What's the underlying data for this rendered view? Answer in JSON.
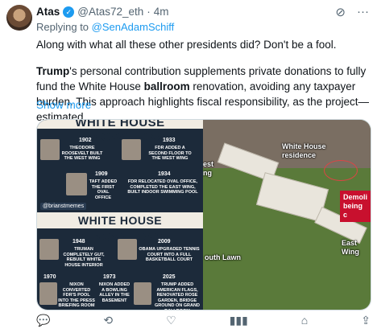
{
  "tweet": {
    "author_name": "Atas",
    "author_handle": "@Atas72_eth",
    "separator": "·",
    "time": "4m",
    "reply_prefix": "Replying to",
    "reply_target": "@SenAdamSchiff",
    "para1": "Along with what all these other presidents did? Don't be a fool.",
    "para2_bold1": "Trump",
    "para2_part1": "'s personal contribution supplements private donations to fully fund the White House ",
    "para2_bold2": "ballroom",
    "para2_part2": " renovation, avoiding any taxpayer burden. This approach highlights fiscal responsibility, as the project—estimated",
    "show_more": "Show more"
  },
  "image_left": {
    "banner_top": "WHITE HOUSE RENOVATIONS",
    "banner_mid": "WHITE HOUSE RENOVATIONS",
    "handle": "@brianstmemes",
    "cards": [
      {
        "year": "1902",
        "caption": "THEODORE ROOSEVELT BUILT THE WEST WING"
      },
      {
        "year": "1933",
        "caption": "FDR ADDED A SECOND FLOOR TO THE WEST WING"
      },
      {
        "year": "1909",
        "caption": "TAFT ADDED THE FIRST OVAL OFFICE"
      },
      {
        "year": "1934",
        "caption": "FDR RELOCATED OVAL OFFICE, COMPLETED THE EAST WING, BUILT INDOOR SWIMMING POOL"
      },
      {
        "year": "1948",
        "caption": "TRUMAN COMPLETELY GUT, REBUILT WHITE HOUSE INTERIOR"
      },
      {
        "year": "2009",
        "caption": "OBAMA UPGRADED TENNIS COURT INTO A FULL BASKETBALL COURT"
      },
      {
        "year": "1970",
        "caption": "NIXON CONVERTED FDR'S POOL INTO THE PRESS BRIEFING ROOM"
      },
      {
        "year": "1973",
        "caption": "NIXON ADDED A BOWLING ALLEY IN THE BASEMENT"
      },
      {
        "year": "2025",
        "caption": "TRUMP ADDED AMERICAN FLAGS, RENOVATED ROSE GARDEN, BRIDGE GROUND ON GRAND BALLROOM"
      }
    ]
  },
  "image_right": {
    "label_residence": "White House residence",
    "label_west": "est ng",
    "label_south": "outh Lawn",
    "label_east": "East Wing",
    "news_ticker": "Demoli being c"
  },
  "actions": {
    "reply_icon": "reply-icon",
    "retweet_icon": "retweet-icon",
    "like_icon": "like-icon",
    "views_icon": "views-icon",
    "bookmark_icon": "bookmark-icon",
    "share_icon": "share-icon"
  },
  "colors": {
    "accent": "#1d9bf0",
    "muted": "#536471",
    "news_red": "#c8102e"
  }
}
